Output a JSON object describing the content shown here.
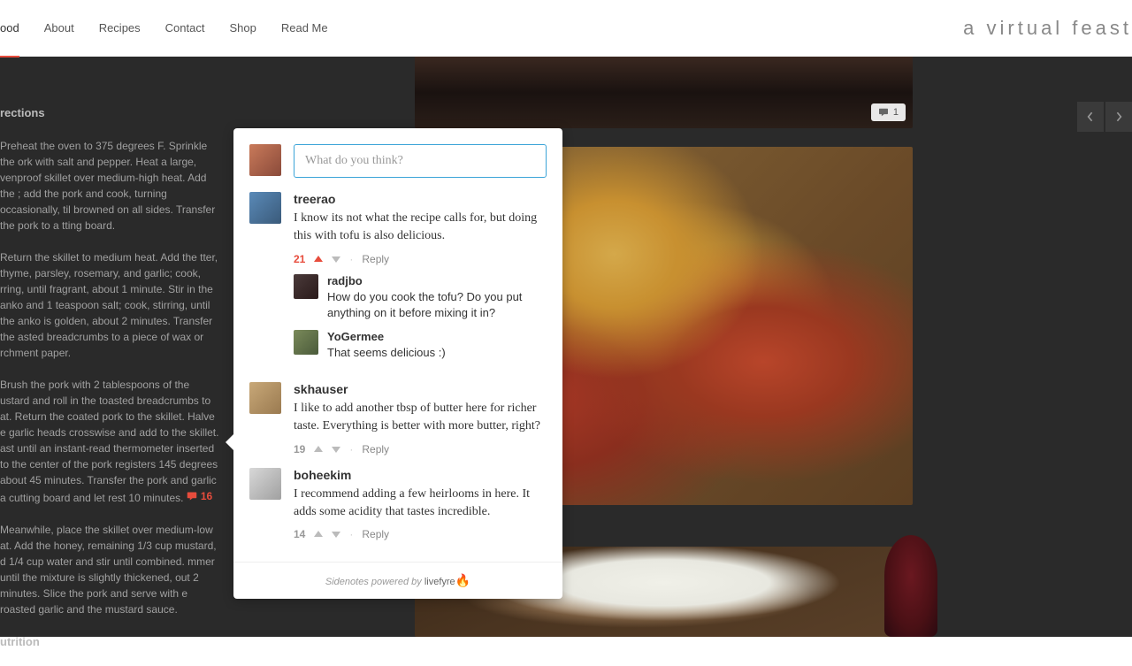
{
  "nav": {
    "items": [
      "ood",
      "About",
      "Recipes",
      "Contact",
      "Shop",
      "Read Me"
    ],
    "active_index": 0
  },
  "brand": "a virtual feast",
  "hero_badge": "1",
  "directions": {
    "heading": "rections",
    "p1": "Preheat the oven to 375 degrees F. Sprinkle the ork with salt and pepper. Heat a large, venproof skillet over medium-high heat. Add the ; add the pork and cook, turning occasionally, til browned on all sides. Transfer the pork to a tting board.",
    "p2": "Return the skillet to medium heat. Add the tter, thyme, parsley, rosemary, and garlic; cook, rring, until fragrant, about 1 minute. Stir in the anko and 1 teaspoon salt; cook, stirring, until the anko is golden, about 2 minutes. Transfer the asted breadcrumbs to a piece of wax or rchment paper.",
    "p3": "Brush the pork with 2 tablespoons of the ustard and roll in the toasted breadcrumbs to at. Return the coated pork to the skillet. Halve e garlic heads crosswise and add to the skillet. ast until an instant-read thermometer inserted to the center of the pork registers 145 degrees about 45 minutes. Transfer the pork and garlic a cutting board and let rest 10 minutes.",
    "p3_count": "16",
    "p4": "Meanwhile, place the skillet over medium-low at. Add the honey, remaining 1/3 cup mustard, d 1/4 cup water and stir until combined. mmer until the mixture is slightly thickened, out 2 minutes. Slice the pork and serve with e roasted garlic and the mustard sauce.",
    "nutrition_heading": "utrition"
  },
  "sidenote": {
    "input_placeholder": "What do you think?",
    "footer_prefix": "Sidenotes powered by",
    "footer_brand": "livefyre",
    "reply_label": "Reply",
    "comments": [
      {
        "user": "treerao",
        "text": "I know its not what the recipe calls for, but doing this with tofu is also delicious.",
        "votes": "21",
        "replies": [
          {
            "user": "radjbo",
            "text": "How do you cook the tofu? Do you put anything on it before mixing it in?"
          },
          {
            "user": "YoGermee",
            "text": "That seems delicious :)"
          }
        ]
      },
      {
        "user": "skhauser",
        "text": "I like to add another tbsp of butter here for richer taste. Everything is better with more butter, right?",
        "votes": "19",
        "replies": []
      },
      {
        "user": "boheekim",
        "text": "I recommend adding a few heirlooms in here. It adds some acidity that tastes incredible.",
        "votes": "14",
        "replies": []
      }
    ]
  }
}
